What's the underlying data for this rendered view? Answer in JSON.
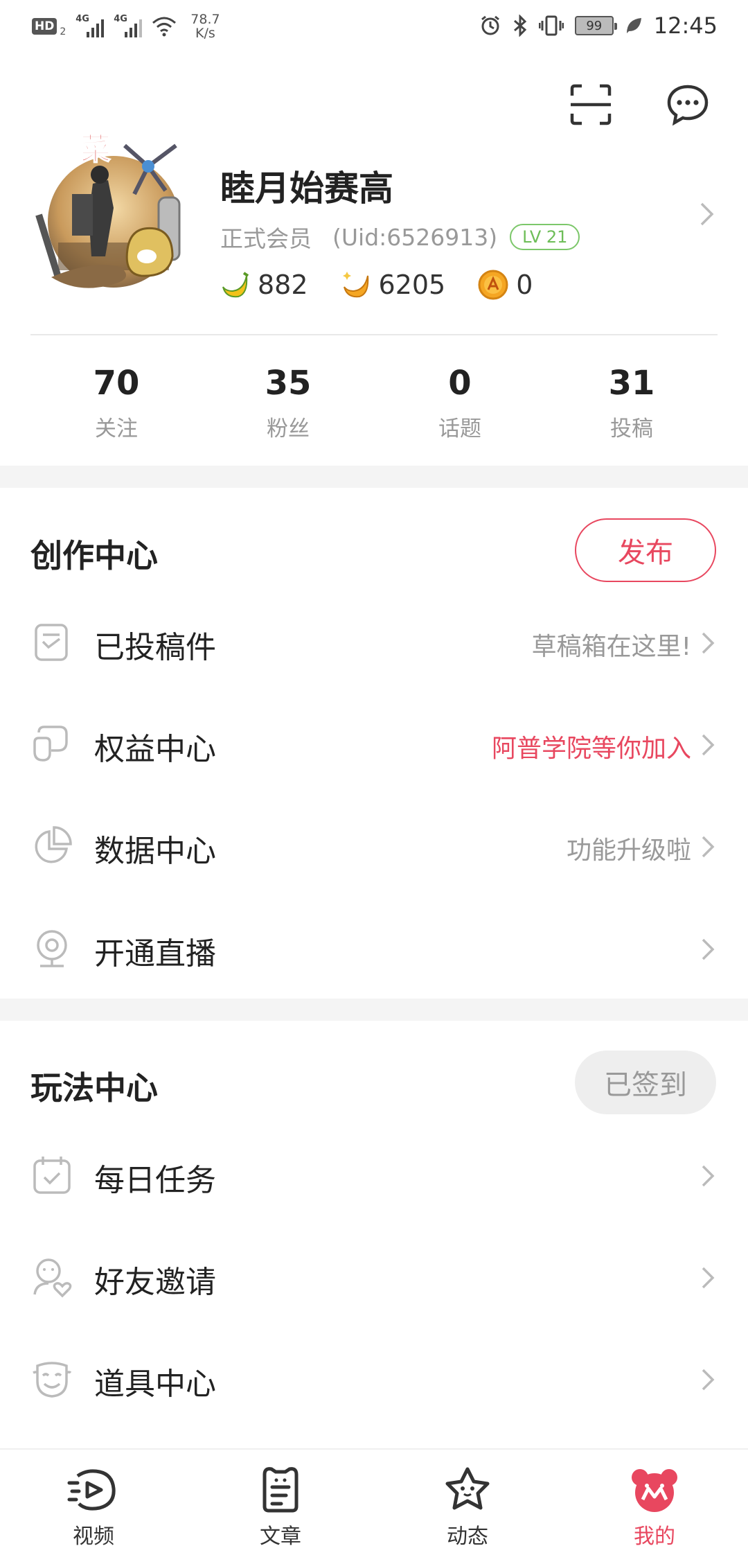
{
  "status_bar": {
    "hd": "HD",
    "hd_sub": "2",
    "signal1": "4G",
    "signal2": "4G",
    "speed_value": "78.7",
    "speed_unit": "K/s",
    "battery": "99",
    "time": "12:45"
  },
  "profile": {
    "nickname": "睦月始赛高",
    "member_type": "正式会员",
    "uid": "(Uid:6526913)",
    "level": "LV 21",
    "bananas": "882",
    "gold_bananas": "6205",
    "coins": "0"
  },
  "stats": [
    {
      "value": "70",
      "label": "关注"
    },
    {
      "value": "35",
      "label": "粉丝"
    },
    {
      "value": "0",
      "label": "话题"
    },
    {
      "value": "31",
      "label": "投稿"
    }
  ],
  "creation_center": {
    "title": "创作中心",
    "button": "发布",
    "items": [
      {
        "label": "已投稿件",
        "hint": "草稿箱在这里!"
      },
      {
        "label": "权益中心",
        "hint": "阿普学院等你加入"
      },
      {
        "label": "数据中心",
        "hint": "功能升级啦"
      },
      {
        "label": "开通直播",
        "hint": ""
      }
    ]
  },
  "play_center": {
    "title": "玩法中心",
    "button": "已签到",
    "items": [
      {
        "label": "每日任务"
      },
      {
        "label": "好友邀请"
      },
      {
        "label": "道具中心"
      }
    ]
  },
  "bottom_nav": [
    {
      "label": "视频"
    },
    {
      "label": "文章"
    },
    {
      "label": "动态"
    },
    {
      "label": "我的"
    }
  ],
  "colors": {
    "accent": "#e8475f",
    "level_green": "#6dbd57"
  }
}
